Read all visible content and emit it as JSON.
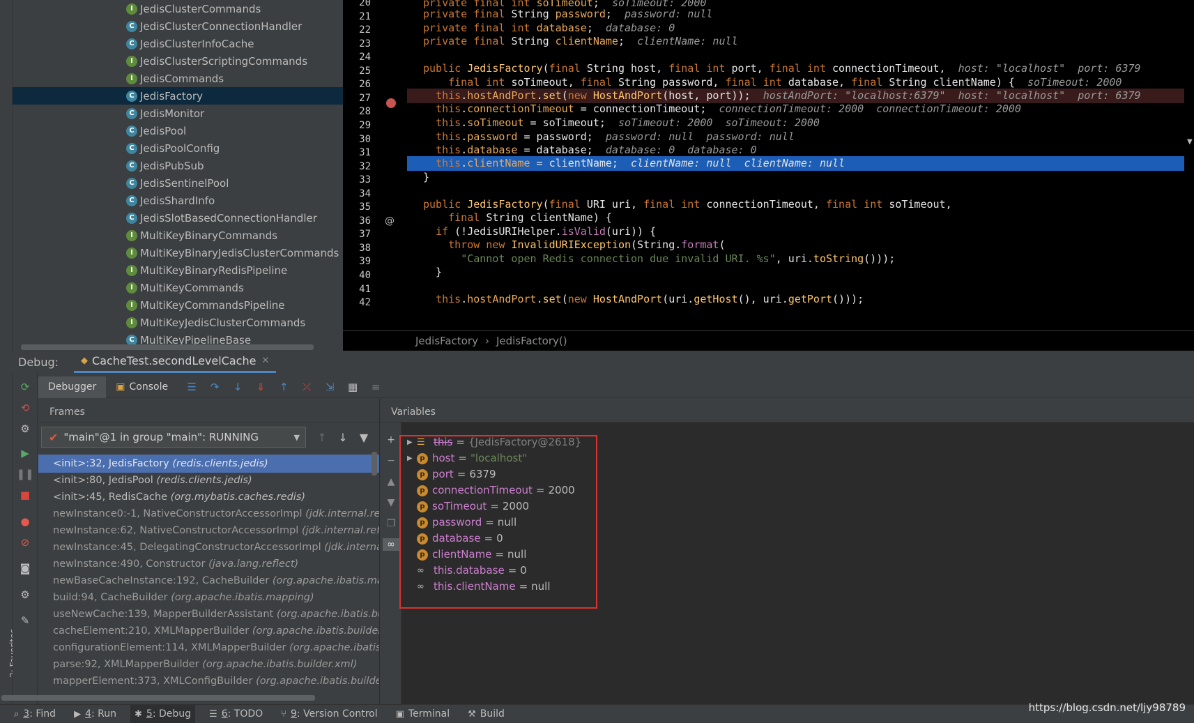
{
  "project_tree": {
    "items": [
      {
        "label": "JedisClusterCommands",
        "icon": "interface-icon",
        "kind": "i"
      },
      {
        "label": "JedisClusterConnectionHandler",
        "icon": "class-icon",
        "kind": "c"
      },
      {
        "label": "JedisClusterInfoCache",
        "icon": "class-icon",
        "kind": "c"
      },
      {
        "label": "JedisClusterScriptingCommands",
        "icon": "interface-icon",
        "kind": "i"
      },
      {
        "label": "JedisCommands",
        "icon": "interface-icon",
        "kind": "i"
      },
      {
        "label": "JedisFactory",
        "icon": "class-icon",
        "kind": "c",
        "selected": true
      },
      {
        "label": "JedisMonitor",
        "icon": "class-icon",
        "kind": "c"
      },
      {
        "label": "JedisPool",
        "icon": "class-icon",
        "kind": "c"
      },
      {
        "label": "JedisPoolConfig",
        "icon": "class-icon",
        "kind": "c"
      },
      {
        "label": "JedisPubSub",
        "icon": "class-icon",
        "kind": "c"
      },
      {
        "label": "JedisSentinelPool",
        "icon": "class-icon",
        "kind": "c"
      },
      {
        "label": "JedisShardInfo",
        "icon": "class-icon",
        "kind": "c"
      },
      {
        "label": "JedisSlotBasedConnectionHandler",
        "icon": "class-icon",
        "kind": "c"
      },
      {
        "label": "MultiKeyBinaryCommands",
        "icon": "interface-icon",
        "kind": "i"
      },
      {
        "label": "MultiKeyBinaryJedisClusterCommands",
        "icon": "interface-icon",
        "kind": "i"
      },
      {
        "label": "MultiKeyBinaryRedisPipeline",
        "icon": "interface-icon",
        "kind": "i"
      },
      {
        "label": "MultiKeyCommands",
        "icon": "interface-icon",
        "kind": "i"
      },
      {
        "label": "MultiKeyCommandsPipeline",
        "icon": "interface-icon",
        "kind": "i"
      },
      {
        "label": "MultiKeyJedisClusterCommands",
        "icon": "interface-icon",
        "kind": "i"
      },
      {
        "label": "MultiKeyPipelineBase",
        "icon": "class-icon",
        "kind": "c"
      }
    ]
  },
  "editor": {
    "line_numbers": [
      "20",
      "21",
      "22",
      "23",
      "24",
      "25",
      "26",
      "27",
      "28",
      "29",
      "30",
      "31",
      "32",
      "33",
      "34",
      "35",
      "36",
      "37",
      "38",
      "39",
      "40",
      "41",
      "42"
    ],
    "breakpoint_line": "27",
    "current_line": "32",
    "breadcrumb": [
      "JedisFactory",
      "JedisFactory()"
    ]
  },
  "debug": {
    "label": "Debug:",
    "session_tab": "CacheTest.secondLevelCache",
    "tabs": {
      "debugger": "Debugger",
      "console": "Console"
    },
    "frames_header": "Frames",
    "variables_header": "Variables",
    "thread": "\"main\"@1 in group \"main\": RUNNING",
    "frames": [
      {
        "method": "<init>:32, JedisFactory",
        "pkg": "(redis.clients.jedis)",
        "selected": true
      },
      {
        "method": "<init>:80, JedisPool",
        "pkg": "(redis.clients.jedis)"
      },
      {
        "method": "<init>:45, RedisCache",
        "pkg": "(org.mybatis.caches.redis)"
      },
      {
        "method": "newInstance0:-1, NativeConstructorAccessorImpl",
        "pkg": "(jdk.internal.reflect)"
      },
      {
        "method": "newInstance:62, NativeConstructorAccessorImpl",
        "pkg": "(jdk.internal.reflect)"
      },
      {
        "method": "newInstance:45, DelegatingConstructorAccessorImpl",
        "pkg": "(jdk.internal.reflect)"
      },
      {
        "method": "newInstance:490, Constructor",
        "pkg": "(java.lang.reflect)"
      },
      {
        "method": "newBaseCacheInstance:192, CacheBuilder",
        "pkg": "(org.apache.ibatis.mapping)"
      },
      {
        "method": "build:94, CacheBuilder",
        "pkg": "(org.apache.ibatis.mapping)"
      },
      {
        "method": "useNewCache:139, MapperBuilderAssistant",
        "pkg": "(org.apache.ibatis.builder)"
      },
      {
        "method": "cacheElement:210, XMLMapperBuilder",
        "pkg": "(org.apache.ibatis.builder.xml)"
      },
      {
        "method": "configurationElement:114, XMLMapperBuilder",
        "pkg": "(org.apache.ibatis.builder.xml)"
      },
      {
        "method": "parse:92, XMLMapperBuilder",
        "pkg": "(org.apache.ibatis.builder.xml)"
      },
      {
        "method": "mapperElement:373, XMLConfigBuilder",
        "pkg": "(org.apache.ibatis.builder.xml)"
      }
    ],
    "variables": [
      {
        "name": "this",
        "value": "{JedisFactory@2618}",
        "kind": "object",
        "expandable": true
      },
      {
        "name": "host",
        "value": "\"localhost\"",
        "kind": "string",
        "expandable": true
      },
      {
        "name": "port",
        "value": "6379",
        "kind": "param"
      },
      {
        "name": "connectionTimeout",
        "value": "2000",
        "kind": "param"
      },
      {
        "name": "soTimeout",
        "value": "2000",
        "kind": "param"
      },
      {
        "name": "password",
        "value": "null",
        "kind": "param"
      },
      {
        "name": "database",
        "value": "0",
        "kind": "param"
      },
      {
        "name": "clientName",
        "value": "null",
        "kind": "param"
      },
      {
        "name": "this.database",
        "value": "0",
        "kind": "watch"
      },
      {
        "name": "this.clientName",
        "value": "null",
        "kind": "watch"
      }
    ]
  },
  "bottom_bar": [
    {
      "num": "3",
      "label": ": Find",
      "icon": "search-icon"
    },
    {
      "num": "4",
      "label": ": Run",
      "icon": "run-icon"
    },
    {
      "num": "5",
      "label": ": Debug",
      "icon": "debug-icon",
      "active": true
    },
    {
      "num": "6",
      "label": ": TODO",
      "icon": "todo-icon"
    },
    {
      "num": "9",
      "label": ": Version Control",
      "icon": "vcs-icon"
    },
    {
      "num": "",
      "label": "Terminal",
      "icon": "terminal-icon"
    },
    {
      "num": "",
      "label": "Build",
      "icon": "build-icon"
    }
  ],
  "favorites_label": "2: Favorites",
  "watermark": "https://blog.csdn.net/ljy98789"
}
